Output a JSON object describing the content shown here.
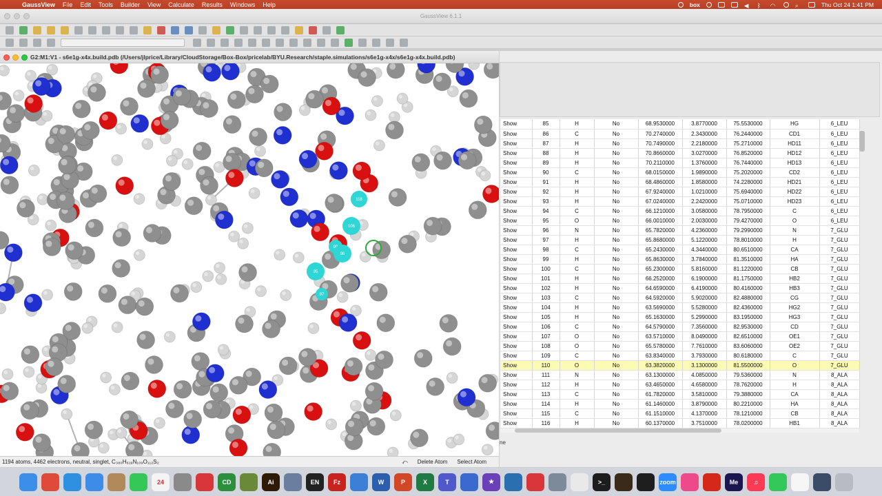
{
  "menubar": {
    "app": "GaussView",
    "items": [
      "File",
      "Edit",
      "Tools",
      "Builder",
      "View",
      "Calculate",
      "Results",
      "Windows",
      "Help"
    ],
    "status_items": [
      "box"
    ],
    "datetime": "Thu Oct 24  1:41 PM"
  },
  "main_window": {
    "title": "GaussView 6.1.1"
  },
  "viewer": {
    "title": "G2:M1:V1 - s6e1g-x4x.build.pdb (/Users/jlprice/Library/CloudStorage/Box-Box/pricelab/BYU.Research/staple.simulations/s6e1g-x4x/s6e1g-x4x.build.pdb)",
    "status_left": "1194 atoms, 4462 electrons, neutral, singlet, C₃₈₀H₆₁₉N₁₀₉O₁₁₂S₂",
    "delete_atom": "Delete Atom",
    "select_atom": "Select Atom",
    "atom_labels": [
      "118",
      "106",
      "99",
      "98",
      "95",
      "97"
    ],
    "colors": {
      "carbon": "#8f8f8f",
      "hydrogen": "#d6d6d6",
      "nitrogen": "#1f2fd0",
      "oxygen": "#d81010",
      "selected": "#2fd6d6"
    }
  },
  "table": {
    "rows": [
      {
        "show": "Show",
        "num": "85",
        "el": "H",
        "frozen": "No",
        "x": "68.9530000",
        "y": "3.8770000",
        "z": "75.5530000",
        "name": "HG",
        "res": "6_LEU"
      },
      {
        "show": "Show",
        "num": "86",
        "el": "C",
        "frozen": "No",
        "x": "70.2740000",
        "y": "2.3430000",
        "z": "76.2440000",
        "name": "CD1",
        "res": "6_LEU"
      },
      {
        "show": "Show",
        "num": "87",
        "el": "H",
        "frozen": "No",
        "x": "70.7490000",
        "y": "2.2180000",
        "z": "75.2710000",
        "name": "HD11",
        "res": "6_LEU"
      },
      {
        "show": "Show",
        "num": "88",
        "el": "H",
        "frozen": "No",
        "x": "70.8660000",
        "y": "3.0270000",
        "z": "76.8520000",
        "name": "HD12",
        "res": "6_LEU"
      },
      {
        "show": "Show",
        "num": "89",
        "el": "H",
        "frozen": "No",
        "x": "70.2110000",
        "y": "1.3760000",
        "z": "76.7440000",
        "name": "HD13",
        "res": "6_LEU"
      },
      {
        "show": "Show",
        "num": "90",
        "el": "C",
        "frozen": "No",
        "x": "68.0150000",
        "y": "1.9890000",
        "z": "75.2020000",
        "name": "CD2",
        "res": "6_LEU"
      },
      {
        "show": "Show",
        "num": "91",
        "el": "H",
        "frozen": "No",
        "x": "68.4860000",
        "y": "1.8580000",
        "z": "74.2280000",
        "name": "HD21",
        "res": "6_LEU"
      },
      {
        "show": "Show",
        "num": "92",
        "el": "H",
        "frozen": "No",
        "x": "67.9240000",
        "y": "1.0210000",
        "z": "75.6940000",
        "name": "HD22",
        "res": "6_LEU"
      },
      {
        "show": "Show",
        "num": "93",
        "el": "H",
        "frozen": "No",
        "x": "67.0240000",
        "y": "2.2420000",
        "z": "75.0710000",
        "name": "HD23",
        "res": "6_LEU"
      },
      {
        "show": "Show",
        "num": "94",
        "el": "C",
        "frozen": "No",
        "x": "66.1210000",
        "y": "3.0580000",
        "z": "78.7950000",
        "name": "C",
        "res": "6_LEU"
      },
      {
        "show": "Show",
        "num": "95",
        "el": "O",
        "frozen": "No",
        "x": "66.0010000",
        "y": "2.0030000",
        "z": "79.4270000",
        "name": "O",
        "res": "6_LEU"
      },
      {
        "show": "Show",
        "num": "96",
        "el": "N",
        "frozen": "No",
        "x": "65.7820000",
        "y": "4.2360000",
        "z": "79.2990000",
        "name": "N",
        "res": "7_GLU"
      },
      {
        "show": "Show",
        "num": "97",
        "el": "H",
        "frozen": "No",
        "x": "65.8680000",
        "y": "5.1220000",
        "z": "78.8010000",
        "name": "H",
        "res": "7_GLU"
      },
      {
        "show": "Show",
        "num": "98",
        "el": "C",
        "frozen": "No",
        "x": "65.2430000",
        "y": "4.3440000",
        "z": "80.6510000",
        "name": "CA",
        "res": "7_GLU"
      },
      {
        "show": "Show",
        "num": "99",
        "el": "H",
        "frozen": "No",
        "x": "65.8630000",
        "y": "3.7840000",
        "z": "81.3510000",
        "name": "HA",
        "res": "7_GLU"
      },
      {
        "show": "Show",
        "num": "100",
        "el": "C",
        "frozen": "No",
        "x": "65.2300000",
        "y": "5.8160000",
        "z": "81.1220000",
        "name": "CB",
        "res": "7_GLU"
      },
      {
        "show": "Show",
        "num": "101",
        "el": "H",
        "frozen": "No",
        "x": "66.2520000",
        "y": "6.1900000",
        "z": "81.1750000",
        "name": "HB2",
        "res": "7_GLU"
      },
      {
        "show": "Show",
        "num": "102",
        "el": "H",
        "frozen": "No",
        "x": "64.6590000",
        "y": "6.4190000",
        "z": "80.4160000",
        "name": "HB3",
        "res": "7_GLU"
      },
      {
        "show": "Show",
        "num": "103",
        "el": "C",
        "frozen": "No",
        "x": "64.5920000",
        "y": "5.9020000",
        "z": "82.4880000",
        "name": "CG",
        "res": "7_GLU"
      },
      {
        "show": "Show",
        "num": "104",
        "el": "H",
        "frozen": "No",
        "x": "63.5690000",
        "y": "5.5280000",
        "z": "82.4360000",
        "name": "HG2",
        "res": "7_GLU"
      },
      {
        "show": "Show",
        "num": "105",
        "el": "H",
        "frozen": "No",
        "x": "65.1630000",
        "y": "5.2990000",
        "z": "83.1950000",
        "name": "HG3",
        "res": "7_GLU"
      },
      {
        "show": "Show",
        "num": "106",
        "el": "C",
        "frozen": "No",
        "x": "64.5790000",
        "y": "7.3560000",
        "z": "82.9530000",
        "name": "CD",
        "res": "7_GLU"
      },
      {
        "show": "Show",
        "num": "107",
        "el": "O",
        "frozen": "No",
        "x": "63.5710000",
        "y": "8.0490000",
        "z": "82.6510000",
        "name": "OE1",
        "res": "7_GLU"
      },
      {
        "show": "Show",
        "num": "108",
        "el": "O",
        "frozen": "No",
        "x": "65.5780000",
        "y": "7.7610000",
        "z": "83.6060000",
        "name": "OE2",
        "res": "7_GLU"
      },
      {
        "show": "Show",
        "num": "109",
        "el": "C",
        "frozen": "No",
        "x": "63.8340000",
        "y": "3.7930000",
        "z": "80.6180000",
        "name": "C",
        "res": "7_GLU"
      },
      {
        "show": "Show",
        "num": "110",
        "el": "O",
        "frozen": "No",
        "x": "63.3820000",
        "y": "3.1300000",
        "z": "81.5500000",
        "name": "O",
        "res": "7_GLU",
        "selected": true
      },
      {
        "show": "Show",
        "num": "111",
        "el": "N",
        "frozen": "No",
        "x": "63.1300000",
        "y": "4.0850000",
        "z": "79.5360000",
        "name": "N",
        "res": "8_ALA"
      },
      {
        "show": "Show",
        "num": "112",
        "el": "H",
        "frozen": "No",
        "x": "63.4650000",
        "y": "4.6580000",
        "z": "78.7620000",
        "name": "H",
        "res": "8_ALA"
      },
      {
        "show": "Show",
        "num": "113",
        "el": "C",
        "frozen": "No",
        "x": "61.7820000",
        "y": "3.5810000",
        "z": "79.3880000",
        "name": "CA",
        "res": "8_ALA"
      },
      {
        "show": "Show",
        "num": "114",
        "el": "H",
        "frozen": "No",
        "x": "61.1460000",
        "y": "3.8790000",
        "z": "80.2210000",
        "name": "HA",
        "res": "8_ALA"
      },
      {
        "show": "Show",
        "num": "115",
        "el": "C",
        "frozen": "No",
        "x": "61.1510000",
        "y": "4.1370000",
        "z": "78.1210000",
        "name": "CB",
        "res": "8_ALA"
      },
      {
        "show": "Show",
        "num": "116",
        "el": "H",
        "frozen": "No",
        "x": "60.1370000",
        "y": "3.7510000",
        "z": "78.0200000",
        "name": "HB1",
        "res": "8_ALA"
      }
    ],
    "footer_text": "ne"
  },
  "dock": {
    "apps": [
      {
        "name": "finder",
        "label": "",
        "color": "#3b8fe8"
      },
      {
        "name": "chrome",
        "label": "",
        "color": "#e04a3a"
      },
      {
        "name": "safari",
        "label": "",
        "color": "#2f8fe0"
      },
      {
        "name": "mail",
        "label": "",
        "color": "#3d8ce8"
      },
      {
        "name": "contacts",
        "label": "",
        "color": "#b08a5a"
      },
      {
        "name": "messages",
        "label": "",
        "color": "#36c759"
      },
      {
        "name": "calendar",
        "label": "24",
        "color": "#f4f4f4"
      },
      {
        "name": "system-settings",
        "label": "",
        "color": "#8a8a8a"
      },
      {
        "name": "app-red",
        "label": "",
        "color": "#d8363a"
      },
      {
        "name": "chemdraw",
        "label": "CD",
        "color": "#2b8f3e"
      },
      {
        "name": "chem3d",
        "label": "",
        "color": "#6a8a3a"
      },
      {
        "name": "illustrator",
        "label": "Ai",
        "color": "#2e1a05"
      },
      {
        "name": "tool-blue",
        "label": "",
        "color": "#6a7fa0"
      },
      {
        "name": "endnote",
        "label": "EN",
        "color": "#222222"
      },
      {
        "name": "filezilla",
        "label": "Fz",
        "color": "#c8231f"
      },
      {
        "name": "xcode",
        "label": "",
        "color": "#3b7fd6"
      },
      {
        "name": "word",
        "label": "W",
        "color": "#2b5fae"
      },
      {
        "name": "powerpoint",
        "label": "P",
        "color": "#d24726"
      },
      {
        "name": "excel",
        "label": "X",
        "color": "#1f7a43"
      },
      {
        "name": "teams",
        "label": "T",
        "color": "#5059c9"
      },
      {
        "name": "pen-tool",
        "label": "",
        "color": "#3a6ad0"
      },
      {
        "name": "imovie",
        "label": "★",
        "color": "#6b3fb8"
      },
      {
        "name": "app-globe",
        "label": "",
        "color": "#2a6fb0"
      },
      {
        "name": "app-red2",
        "label": "",
        "color": "#d8363a"
      },
      {
        "name": "app-gray",
        "label": "",
        "color": "#7c8a9a"
      },
      {
        "name": "textedit",
        "label": "",
        "color": "#e9e9e9"
      },
      {
        "name": "terminal",
        "label": ">_",
        "color": "#1d1d1d"
      },
      {
        "name": "app-dark",
        "label": "",
        "color": "#3a2a1a"
      },
      {
        "name": "activity",
        "label": "",
        "color": "#1e1e1e"
      },
      {
        "name": "zoom",
        "label": "zoom",
        "color": "#2d8cff"
      },
      {
        "name": "app-pink",
        "label": "",
        "color": "#ee4a8a"
      },
      {
        "name": "acrobat",
        "label": "",
        "color": "#d5281b"
      },
      {
        "name": "media-encoder",
        "label": "Me",
        "color": "#1a1650"
      },
      {
        "name": "music",
        "label": "♫",
        "color": "#fb3b55"
      },
      {
        "name": "facetime",
        "label": "",
        "color": "#34c759"
      },
      {
        "name": "document",
        "label": "",
        "color": "#f6f6f6"
      },
      {
        "name": "screenshot",
        "label": "",
        "color": "#3a4c68"
      },
      {
        "name": "trash",
        "label": "",
        "color": "#b8bcc2"
      }
    ]
  }
}
